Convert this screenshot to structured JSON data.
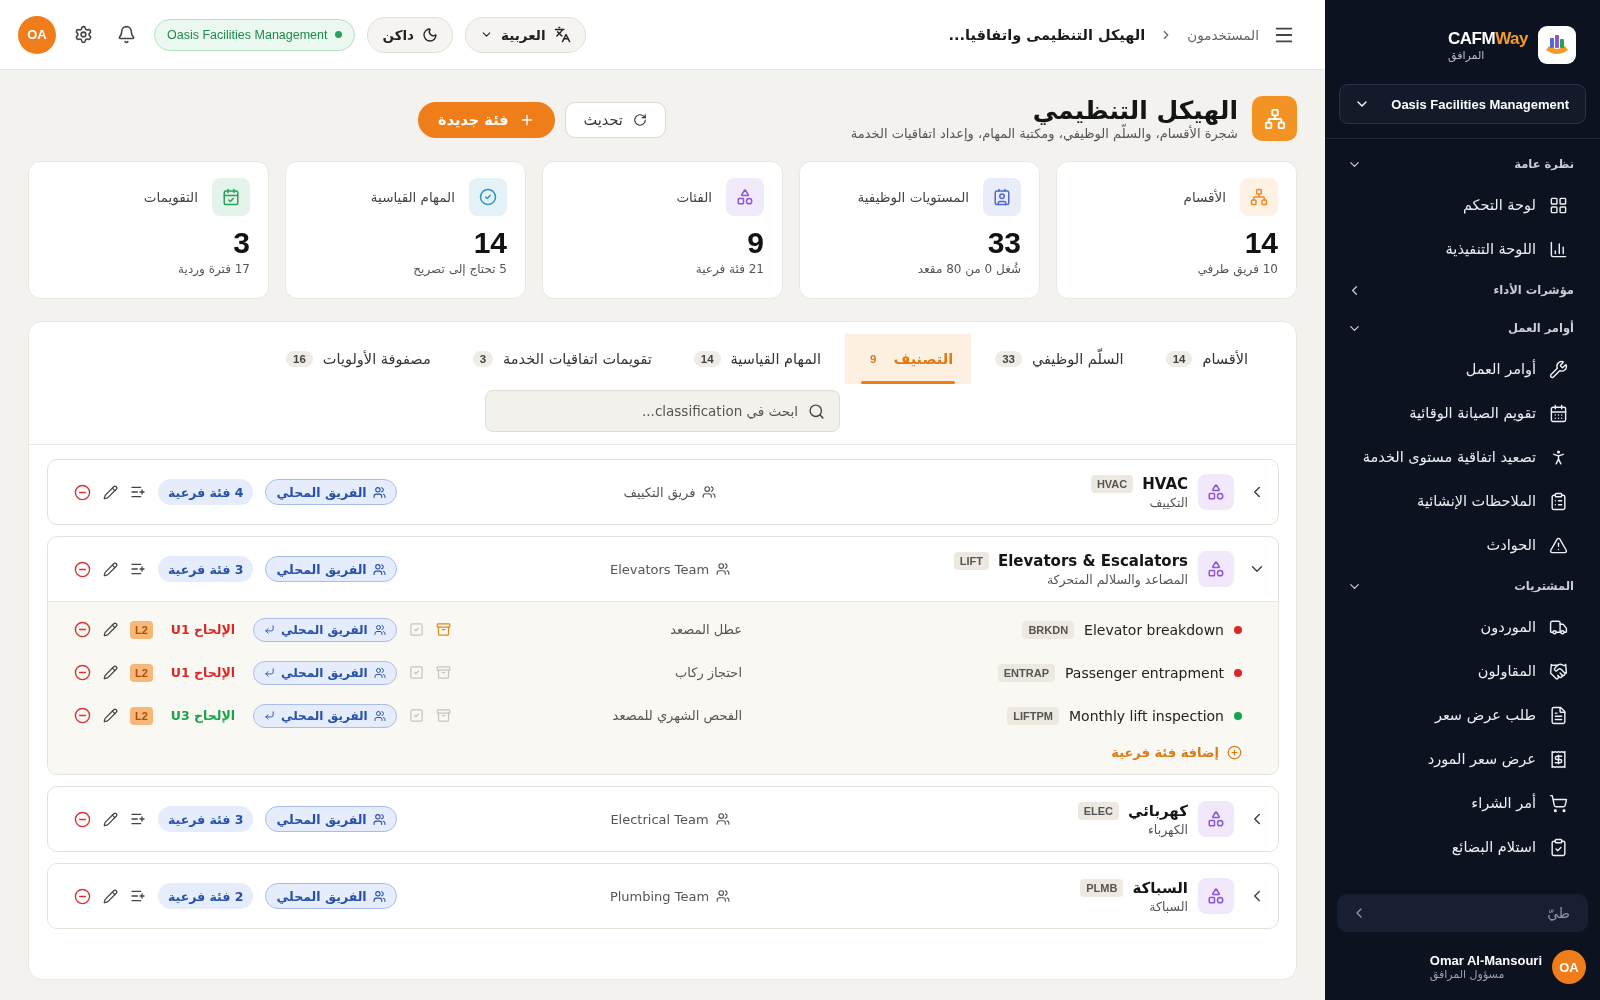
{
  "sidebar": {
    "brand_main": "CAFM",
    "brand_accent": "Way",
    "brand_subtitle": "المرافق",
    "org_select": "Oasis Facilities Management",
    "sections": [
      {
        "title": "نظرة عامة",
        "expanded": true,
        "items": [
          {
            "label": "لوحة التحكم"
          },
          {
            "label": "اللوحة التنفيذية"
          }
        ]
      },
      {
        "title": "مؤشرات الأداء",
        "expanded": false
      },
      {
        "title": "أوامر العمل",
        "expanded": true,
        "items": [
          {
            "label": "أوامر العمل"
          },
          {
            "label": "تقويم الصيانة الوقائية"
          },
          {
            "label": "تصعيد اتفاقية مستوى الخدمة"
          },
          {
            "label": "الملاحظات الإنشائية"
          },
          {
            "label": "الحوادث"
          }
        ]
      },
      {
        "title": "المشتريات",
        "expanded": true,
        "items": [
          {
            "label": "الموردون"
          },
          {
            "label": "المقاولون"
          },
          {
            "label": "طلب عرض سعر"
          },
          {
            "label": "عرض سعر المورد"
          },
          {
            "label": "أمر الشراء"
          },
          {
            "label": "استلام البضائع"
          }
        ]
      }
    ],
    "collapse_label": "طيّ",
    "user": {
      "initials": "OA",
      "name": "Omar Al-Mansouri",
      "role": "مسؤول المرافق"
    }
  },
  "topbar": {
    "breadcrumb": [
      "المستخدمون",
      "الهيكل التنظيمى واتفاقيا..."
    ],
    "language": "العربية",
    "theme": "داكن",
    "org": "Oasis Facilities Management",
    "avatar": "OA"
  },
  "header": {
    "title": "الهيكل التنظيمي",
    "subtitle": "شجرة الأقسام، والسلّم الوظيفي، ومكتبة المهام، وإعداد اتفاقيات الخدمة",
    "refresh": "تحديث",
    "new_button": "فئة جديدة"
  },
  "stats": [
    {
      "label": "الأقسام",
      "value": "14",
      "note": "10 فريق طرفي",
      "color": "#f08a24"
    },
    {
      "label": "المستويات الوظيفية",
      "value": "33",
      "note": "شُغل 0 من 80 مقعد",
      "color": "#4d6bd1"
    },
    {
      "label": "الفئات",
      "value": "9",
      "note": "21 فئة فرعية",
      "color": "#8b55d6"
    },
    {
      "label": "المهام القياسية",
      "value": "14",
      "note": "5 تحتاج إلى تصريح",
      "color": "#2a94c4"
    },
    {
      "label": "التقويمات",
      "value": "3",
      "note": "17 فترة وردية",
      "color": "#25a35a"
    }
  ],
  "tabs": [
    {
      "label": "الأقسام",
      "count": "14",
      "selected": false
    },
    {
      "label": "السلّم الوظيفي",
      "count": "33",
      "selected": false
    },
    {
      "label": "التصنيف",
      "count": "9",
      "selected": true
    },
    {
      "label": "المهام القياسية",
      "count": "14",
      "selected": false
    },
    {
      "label": "تقويمات اتفاقيات الخدمة",
      "count": "3",
      "selected": false
    },
    {
      "label": "مصفوفة الأولويات",
      "count": "16",
      "selected": false
    }
  ],
  "search": {
    "placeholder": "ابحث في classification..."
  },
  "categories": [
    {
      "name": "HVAC",
      "code": "HVAC",
      "subtitle": "التكييف",
      "team": "فريق التكييف",
      "local_team": "الفريق المحلي",
      "subcount": "4 فئة فرعية",
      "expanded": false
    },
    {
      "name": "Elevators & Escalators",
      "code": "LIFT",
      "subtitle": "المصاعد والسلالم المتحركة",
      "team": "Elevators Team",
      "local_team": "الفريق المحلي",
      "subcount": "3 فئة فرعية",
      "expanded": true,
      "children": [
        {
          "name": "Elevator breakdown",
          "code": "BRKDN",
          "color": "#dc2626",
          "team": "عطل المصعد",
          "local_team": "الفريق المحلي",
          "priority": "الإلحاح U1",
          "level": "L2",
          "archive_active": true
        },
        {
          "name": "Passenger entrapment",
          "code": "ENTRAP",
          "color": "#dc2626",
          "team": "احتجاز ركاب",
          "local_team": "الفريق المحلي",
          "priority": "الإلحاح U1",
          "level": "L2",
          "archive_active": false
        },
        {
          "name": "Monthly lift inspection",
          "code": "LIFTPM",
          "color": "#16a34a",
          "team": "الفحص الشهري للمصعد",
          "local_team": "الفريق المحلي",
          "priority": "الإلحاح U3",
          "level": "L2",
          "archive_active": false
        }
      ],
      "add_label": "إضافة فئة فرعية"
    },
    {
      "name": "كهربائي",
      "code": "ELEC",
      "subtitle": "الكهرباء",
      "team": "Electrical Team",
      "local_team": "الفريق المحلي",
      "subcount": "3 فئة فرعية",
      "expanded": false
    },
    {
      "name": "السباكة",
      "code": "PLMB",
      "subtitle": "السباكة",
      "team": "Plumbing Team",
      "local_team": "الفريق المحلي",
      "subcount": "2 فئة فرعية",
      "expanded": false
    }
  ]
}
